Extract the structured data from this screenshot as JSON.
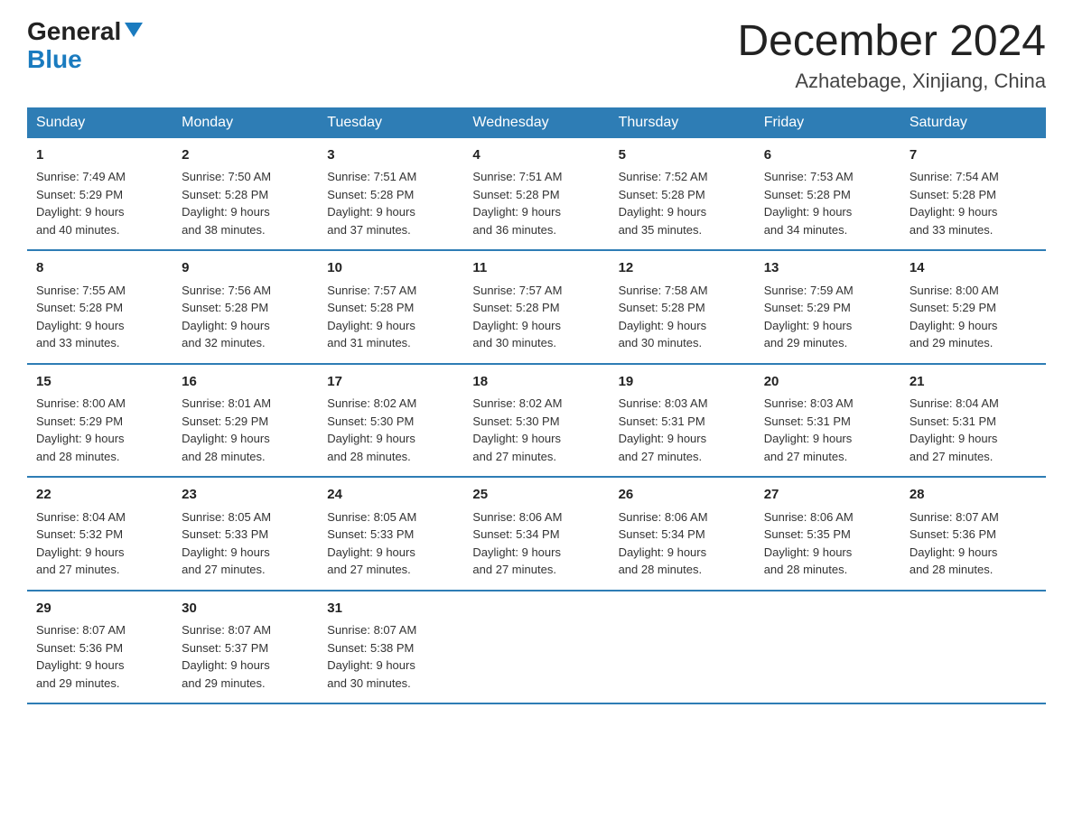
{
  "logo": {
    "general": "General",
    "blue": "Blue"
  },
  "title": "December 2024",
  "location": "Azhatebage, Xinjiang, China",
  "days_of_week": [
    "Sunday",
    "Monday",
    "Tuesday",
    "Wednesday",
    "Thursday",
    "Friday",
    "Saturday"
  ],
  "weeks": [
    [
      {
        "day": "1",
        "info": "Sunrise: 7:49 AM\nSunset: 5:29 PM\nDaylight: 9 hours\nand 40 minutes."
      },
      {
        "day": "2",
        "info": "Sunrise: 7:50 AM\nSunset: 5:28 PM\nDaylight: 9 hours\nand 38 minutes."
      },
      {
        "day": "3",
        "info": "Sunrise: 7:51 AM\nSunset: 5:28 PM\nDaylight: 9 hours\nand 37 minutes."
      },
      {
        "day": "4",
        "info": "Sunrise: 7:51 AM\nSunset: 5:28 PM\nDaylight: 9 hours\nand 36 minutes."
      },
      {
        "day": "5",
        "info": "Sunrise: 7:52 AM\nSunset: 5:28 PM\nDaylight: 9 hours\nand 35 minutes."
      },
      {
        "day": "6",
        "info": "Sunrise: 7:53 AM\nSunset: 5:28 PM\nDaylight: 9 hours\nand 34 minutes."
      },
      {
        "day": "7",
        "info": "Sunrise: 7:54 AM\nSunset: 5:28 PM\nDaylight: 9 hours\nand 33 minutes."
      }
    ],
    [
      {
        "day": "8",
        "info": "Sunrise: 7:55 AM\nSunset: 5:28 PM\nDaylight: 9 hours\nand 33 minutes."
      },
      {
        "day": "9",
        "info": "Sunrise: 7:56 AM\nSunset: 5:28 PM\nDaylight: 9 hours\nand 32 minutes."
      },
      {
        "day": "10",
        "info": "Sunrise: 7:57 AM\nSunset: 5:28 PM\nDaylight: 9 hours\nand 31 minutes."
      },
      {
        "day": "11",
        "info": "Sunrise: 7:57 AM\nSunset: 5:28 PM\nDaylight: 9 hours\nand 30 minutes."
      },
      {
        "day": "12",
        "info": "Sunrise: 7:58 AM\nSunset: 5:28 PM\nDaylight: 9 hours\nand 30 minutes."
      },
      {
        "day": "13",
        "info": "Sunrise: 7:59 AM\nSunset: 5:29 PM\nDaylight: 9 hours\nand 29 minutes."
      },
      {
        "day": "14",
        "info": "Sunrise: 8:00 AM\nSunset: 5:29 PM\nDaylight: 9 hours\nand 29 minutes."
      }
    ],
    [
      {
        "day": "15",
        "info": "Sunrise: 8:00 AM\nSunset: 5:29 PM\nDaylight: 9 hours\nand 28 minutes."
      },
      {
        "day": "16",
        "info": "Sunrise: 8:01 AM\nSunset: 5:29 PM\nDaylight: 9 hours\nand 28 minutes."
      },
      {
        "day": "17",
        "info": "Sunrise: 8:02 AM\nSunset: 5:30 PM\nDaylight: 9 hours\nand 28 minutes."
      },
      {
        "day": "18",
        "info": "Sunrise: 8:02 AM\nSunset: 5:30 PM\nDaylight: 9 hours\nand 27 minutes."
      },
      {
        "day": "19",
        "info": "Sunrise: 8:03 AM\nSunset: 5:31 PM\nDaylight: 9 hours\nand 27 minutes."
      },
      {
        "day": "20",
        "info": "Sunrise: 8:03 AM\nSunset: 5:31 PM\nDaylight: 9 hours\nand 27 minutes."
      },
      {
        "day": "21",
        "info": "Sunrise: 8:04 AM\nSunset: 5:31 PM\nDaylight: 9 hours\nand 27 minutes."
      }
    ],
    [
      {
        "day": "22",
        "info": "Sunrise: 8:04 AM\nSunset: 5:32 PM\nDaylight: 9 hours\nand 27 minutes."
      },
      {
        "day": "23",
        "info": "Sunrise: 8:05 AM\nSunset: 5:33 PM\nDaylight: 9 hours\nand 27 minutes."
      },
      {
        "day": "24",
        "info": "Sunrise: 8:05 AM\nSunset: 5:33 PM\nDaylight: 9 hours\nand 27 minutes."
      },
      {
        "day": "25",
        "info": "Sunrise: 8:06 AM\nSunset: 5:34 PM\nDaylight: 9 hours\nand 27 minutes."
      },
      {
        "day": "26",
        "info": "Sunrise: 8:06 AM\nSunset: 5:34 PM\nDaylight: 9 hours\nand 28 minutes."
      },
      {
        "day": "27",
        "info": "Sunrise: 8:06 AM\nSunset: 5:35 PM\nDaylight: 9 hours\nand 28 minutes."
      },
      {
        "day": "28",
        "info": "Sunrise: 8:07 AM\nSunset: 5:36 PM\nDaylight: 9 hours\nand 28 minutes."
      }
    ],
    [
      {
        "day": "29",
        "info": "Sunrise: 8:07 AM\nSunset: 5:36 PM\nDaylight: 9 hours\nand 29 minutes."
      },
      {
        "day": "30",
        "info": "Sunrise: 8:07 AM\nSunset: 5:37 PM\nDaylight: 9 hours\nand 29 minutes."
      },
      {
        "day": "31",
        "info": "Sunrise: 8:07 AM\nSunset: 5:38 PM\nDaylight: 9 hours\nand 30 minutes."
      },
      {
        "day": "",
        "info": ""
      },
      {
        "day": "",
        "info": ""
      },
      {
        "day": "",
        "info": ""
      },
      {
        "day": "",
        "info": ""
      }
    ]
  ]
}
